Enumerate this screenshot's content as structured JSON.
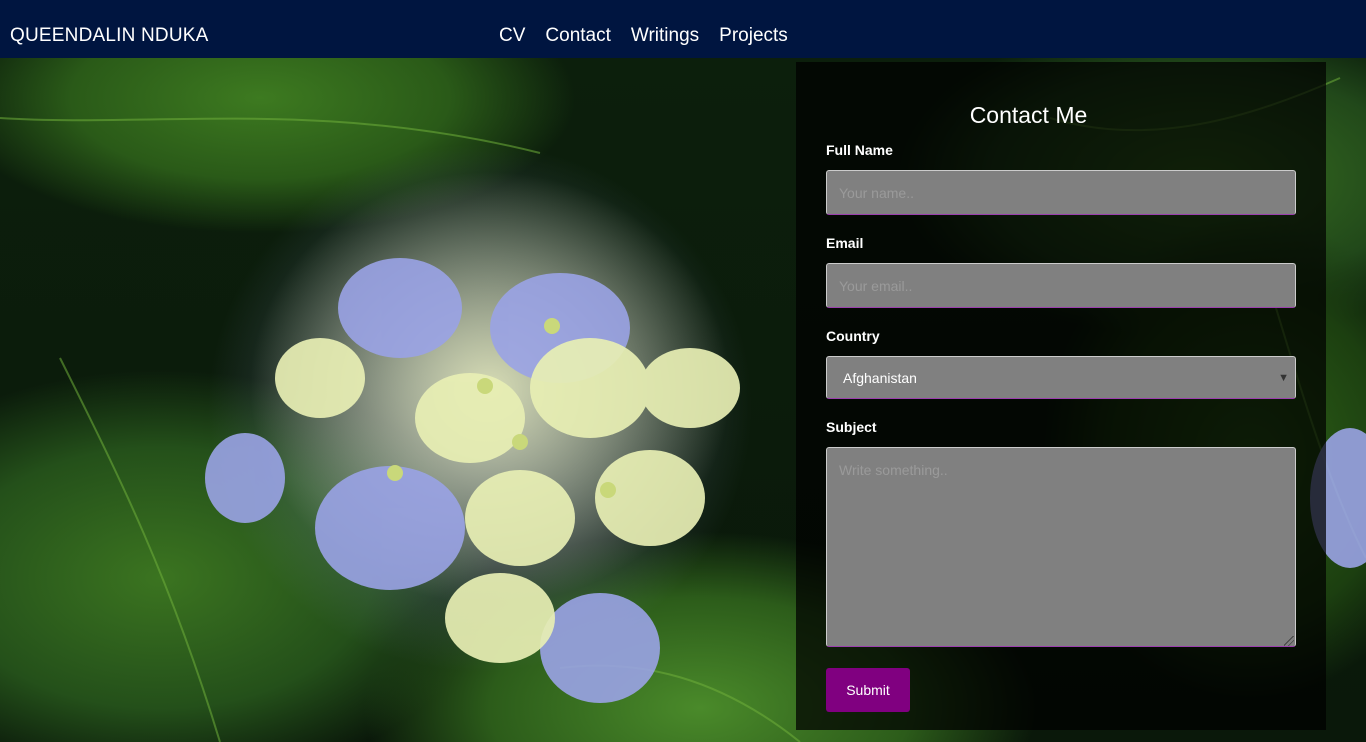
{
  "header": {
    "brand": "QUEENDALIN NDUKA",
    "nav": [
      "CV",
      "Contact",
      "Writings",
      "Projects"
    ]
  },
  "form": {
    "title": "Contact Me",
    "full_name": {
      "label": "Full Name",
      "placeholder": "Your name.."
    },
    "email": {
      "label": "Email",
      "placeholder": "Your email.."
    },
    "country": {
      "label": "Country",
      "selected": "Afghanistan"
    },
    "subject": {
      "label": "Subject",
      "placeholder": "Write something.."
    },
    "submit_label": "Submit"
  },
  "colors": {
    "nav_background": "#001540",
    "submit_button": "#800080",
    "field_background": "#808080"
  }
}
